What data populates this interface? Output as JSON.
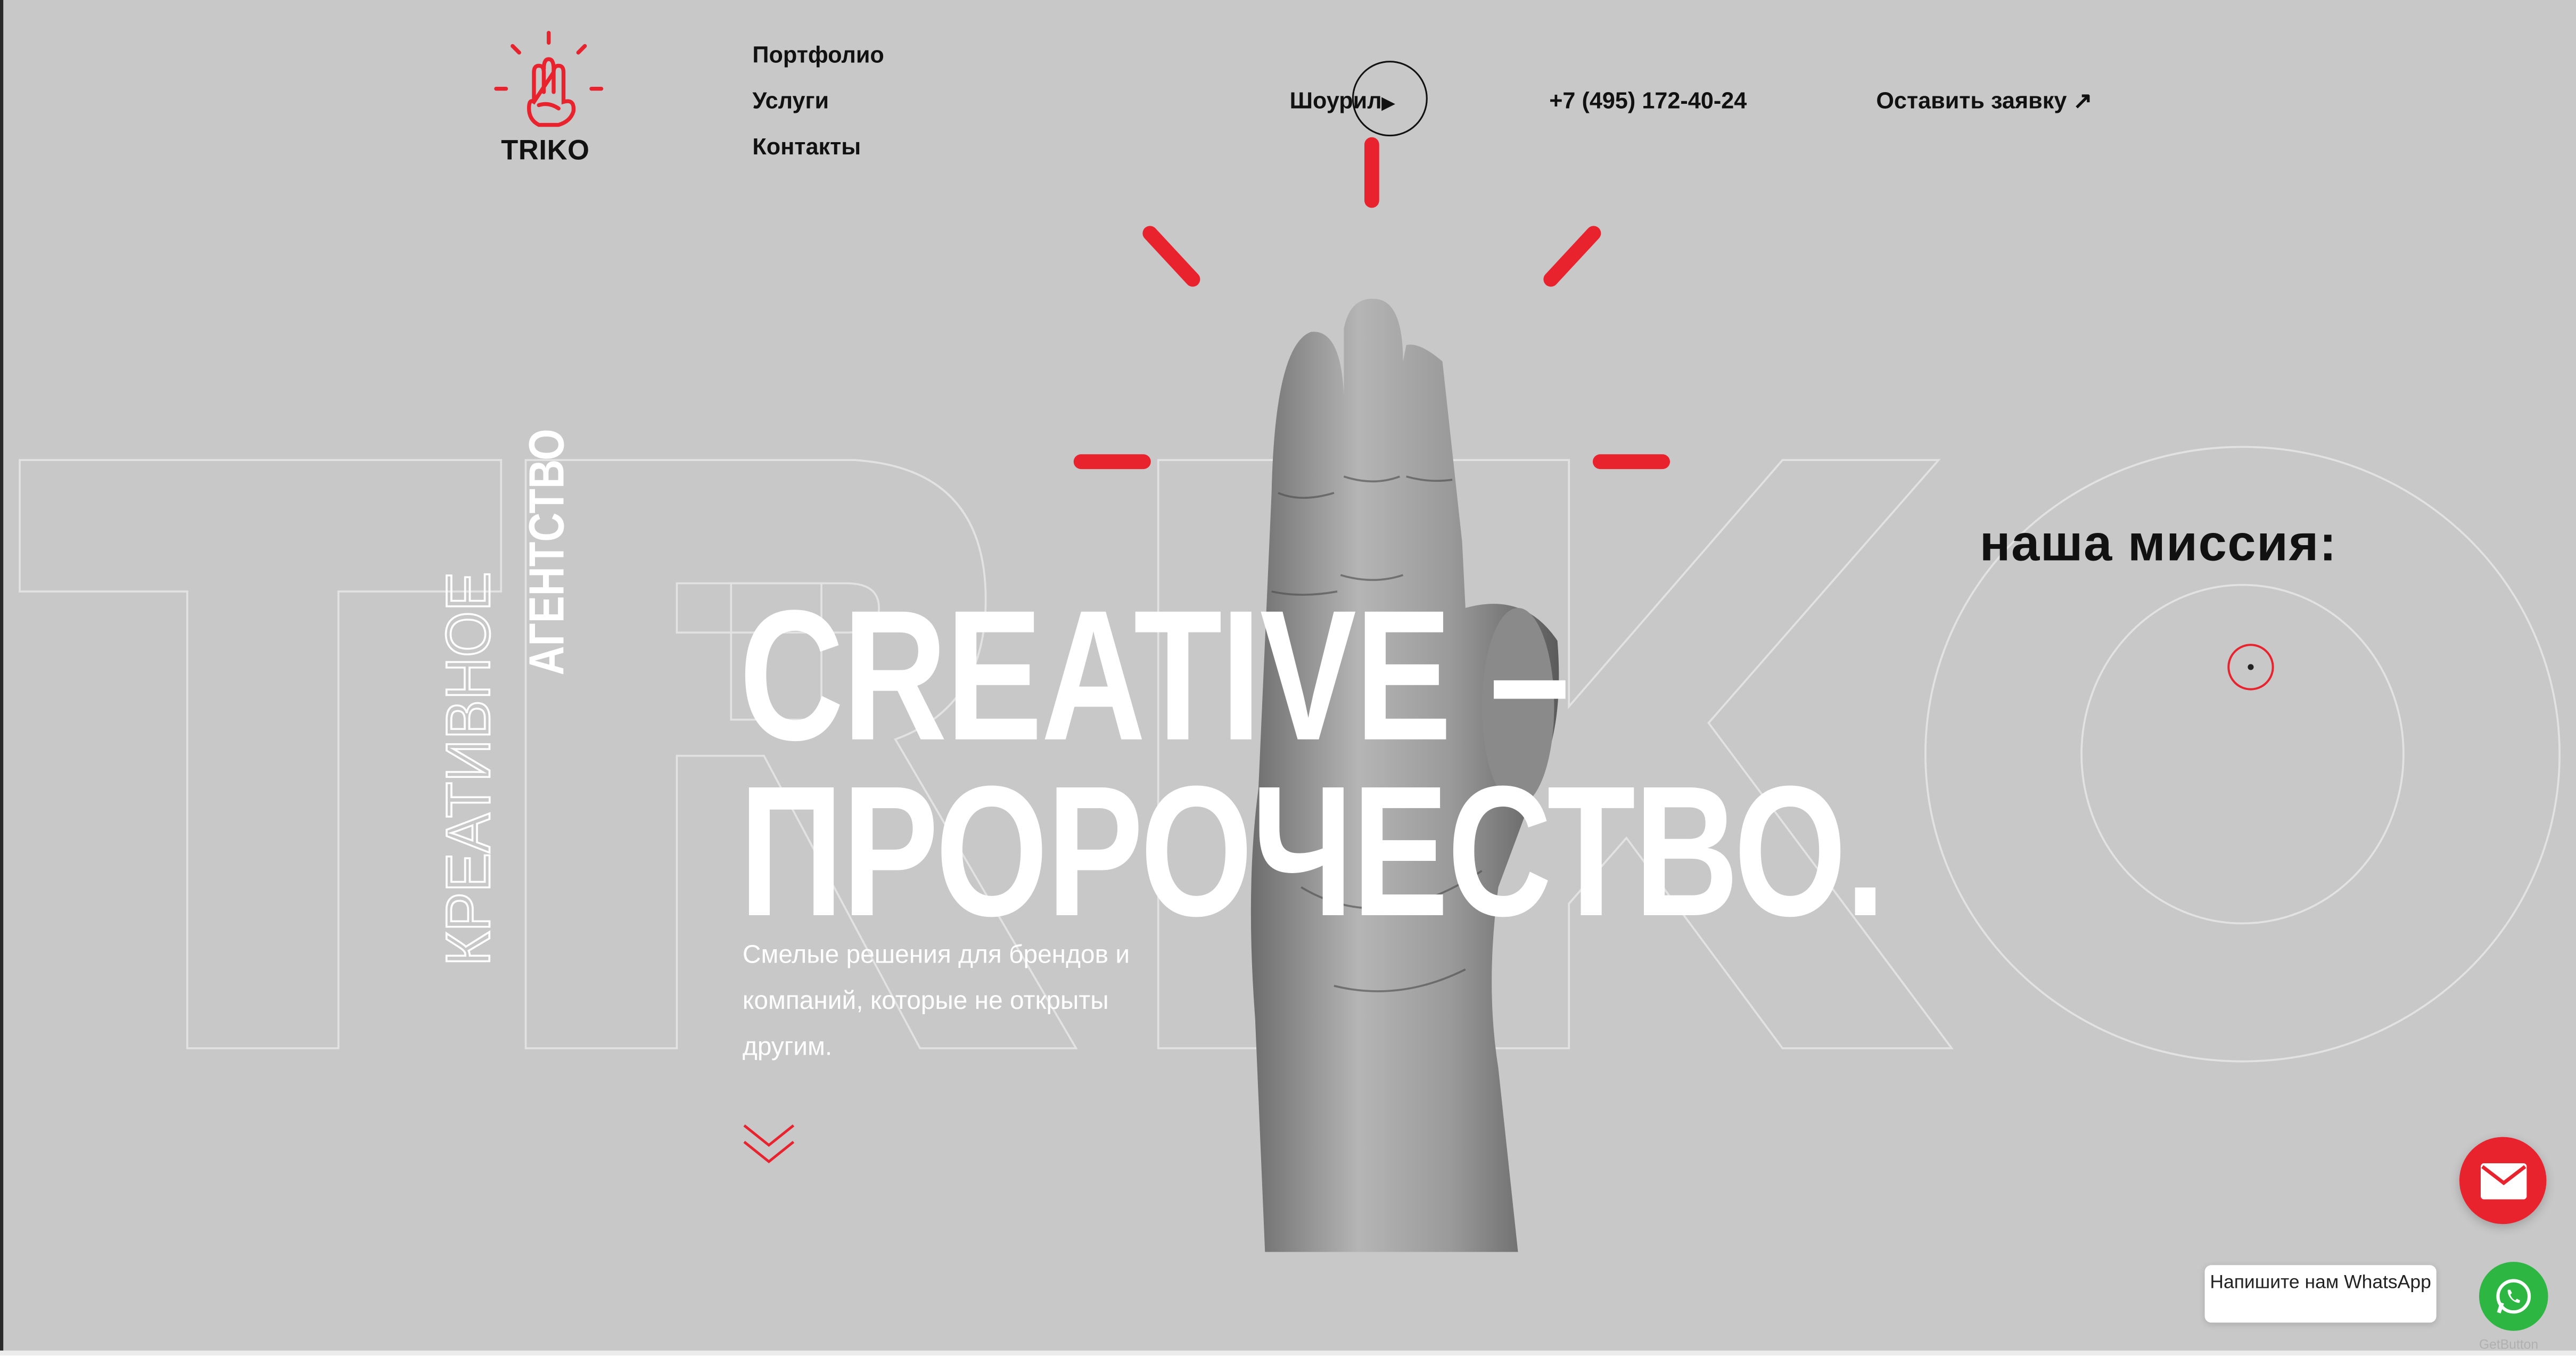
{
  "brand": {
    "name": "TRIKO",
    "accent": "#e8232e"
  },
  "nav": {
    "portfolio": "Портфолио",
    "services": "Услуги",
    "contacts": "Контакты"
  },
  "header": {
    "showroom": "Шоурил",
    "phone": "+7 (495) 172-40-24",
    "request": "Оставить заявку ↗"
  },
  "hero": {
    "vertical_1": "КРЕАТИВНОЕ",
    "vertical_2": "АГЕНТСТВО",
    "headline_line1": "CREATIVE –",
    "headline_line2": "ПРОРОЧЕСТВО.",
    "subtext": "Смелые решения для брендов и компаний, которые не открыты другим.",
    "background_word": "TRIKO"
  },
  "mission": {
    "title": "наша миссия:"
  },
  "widgets": {
    "whatsapp_prompt": "Напишите нам WhatsApp",
    "whatsapp_credit": "GetButton"
  }
}
